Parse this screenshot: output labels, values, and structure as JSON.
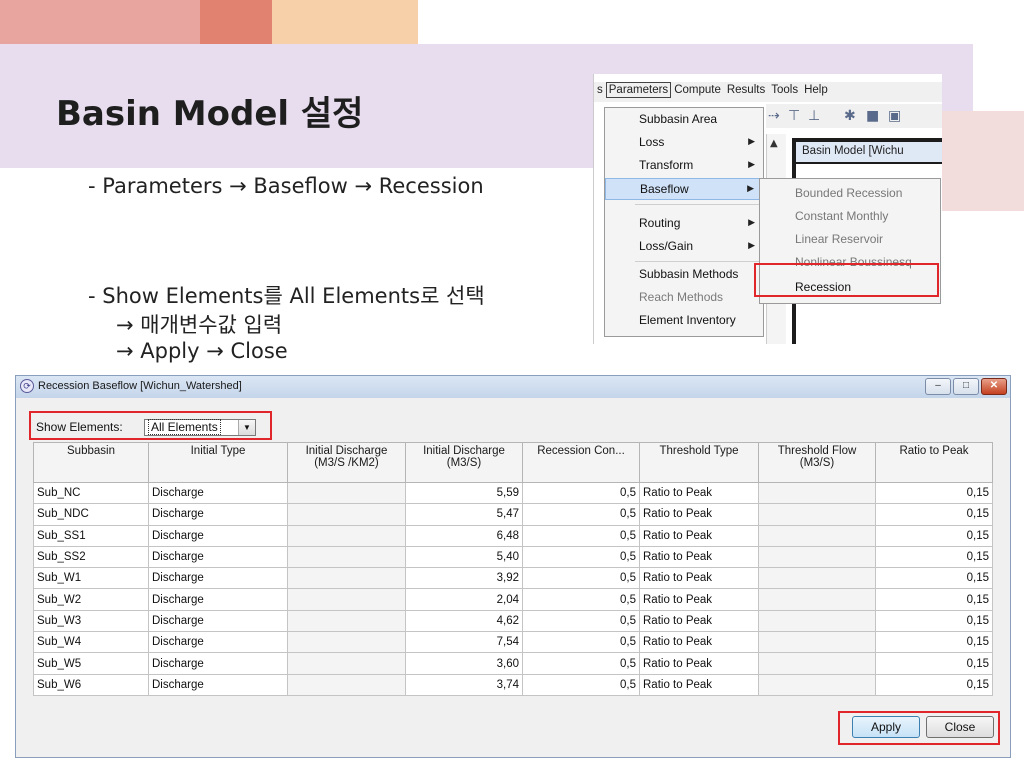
{
  "slide": {
    "title": "Basin Model 설정",
    "bullets": [
      "- Parameters → Baseflow → Recession",
      "- Show Elements를 All Elements로 선택",
      "→ 매개변수값 입력",
      "→ Apply → Close"
    ]
  },
  "menu_screenshot": {
    "menubar": [
      "s",
      "Parameters",
      "Compute",
      "Results",
      "Tools",
      "Help"
    ],
    "active_menu": "Parameters",
    "parameters_menu": [
      {
        "label": "Subbasin Area",
        "submenu": false,
        "disabled": false
      },
      {
        "label": "Loss",
        "submenu": true,
        "disabled": false
      },
      {
        "label": "Transform",
        "submenu": true,
        "disabled": false
      },
      {
        "label": "Baseflow",
        "submenu": true,
        "disabled": false,
        "highlighted": true
      },
      {
        "label": "Routing",
        "submenu": true,
        "disabled": false
      },
      {
        "label": "Loss/Gain",
        "submenu": true,
        "disabled": false
      },
      {
        "label": "Subbasin Methods",
        "submenu": false,
        "disabled": false
      },
      {
        "label": "Reach Methods",
        "submenu": false,
        "disabled": true
      },
      {
        "label": "Element Inventory",
        "submenu": false,
        "disabled": false
      }
    ],
    "baseflow_submenu": [
      {
        "label": "Bounded Recession",
        "disabled": true
      },
      {
        "label": "Constant Monthly",
        "disabled": true
      },
      {
        "label": "Linear Reservoir",
        "disabled": true
      },
      {
        "label": "Nonlinear Boussinesq",
        "disabled": true
      },
      {
        "label": "Recession",
        "disabled": false
      }
    ],
    "background_window_title": "Basin Model [Wichu"
  },
  "dialog": {
    "title": "Recession Baseflow [Wichun_Watershed]",
    "show_elements_label": "Show Elements:",
    "show_elements_value": "All Elements",
    "columns": [
      "Subbasin",
      "Initial Type",
      "Initial Discharge\n(M3/S /KM2)",
      "Initial Discharge\n(M3/S)",
      "Recession Con...",
      "Threshold Type",
      "Threshold Flow\n(M3/S)",
      "Ratio to Peak"
    ],
    "rows": [
      [
        "Sub_NC",
        "Discharge",
        "",
        "5,59",
        "0,5",
        "Ratio to Peak",
        "",
        "0,15"
      ],
      [
        "Sub_NDC",
        "Discharge",
        "",
        "5,47",
        "0,5",
        "Ratio to Peak",
        "",
        "0,15"
      ],
      [
        "Sub_SS1",
        "Discharge",
        "",
        "6,48",
        "0,5",
        "Ratio to Peak",
        "",
        "0,15"
      ],
      [
        "Sub_SS2",
        "Discharge",
        "",
        "5,40",
        "0,5",
        "Ratio to Peak",
        "",
        "0,15"
      ],
      [
        "Sub_W1",
        "Discharge",
        "",
        "3,92",
        "0,5",
        "Ratio to Peak",
        "",
        "0,15"
      ],
      [
        "Sub_W2",
        "Discharge",
        "",
        "2,04",
        "0,5",
        "Ratio to Peak",
        "",
        "0,15"
      ],
      [
        "Sub_W3",
        "Discharge",
        "",
        "4,62",
        "0,5",
        "Ratio to Peak",
        "",
        "0,15"
      ],
      [
        "Sub_W4",
        "Discharge",
        "",
        "7,54",
        "0,5",
        "Ratio to Peak",
        "",
        "0,15"
      ],
      [
        "Sub_W5",
        "Discharge",
        "",
        "3,60",
        "0,5",
        "Ratio to Peak",
        "",
        "0,15"
      ],
      [
        "Sub_W6",
        "Discharge",
        "",
        "3,74",
        "0,5",
        "Ratio to Peak",
        "",
        "0,15"
      ]
    ],
    "buttons": {
      "apply": "Apply",
      "close": "Close"
    },
    "window_controls": {
      "minimize": "–",
      "maximize": "□",
      "close": "✕"
    }
  },
  "colors": {
    "highlight_box": "#e0262b",
    "title_band": "#e8dcef",
    "deco_pink": "#e8a5a0",
    "deco_red": "#e0826f",
    "deco_peach": "#f7cfa9"
  },
  "icons": {
    "dialog_icon": "hms-app-icon",
    "submenu_arrow": "triangle-right-icon",
    "dropdown": "chevron-down-icon"
  }
}
